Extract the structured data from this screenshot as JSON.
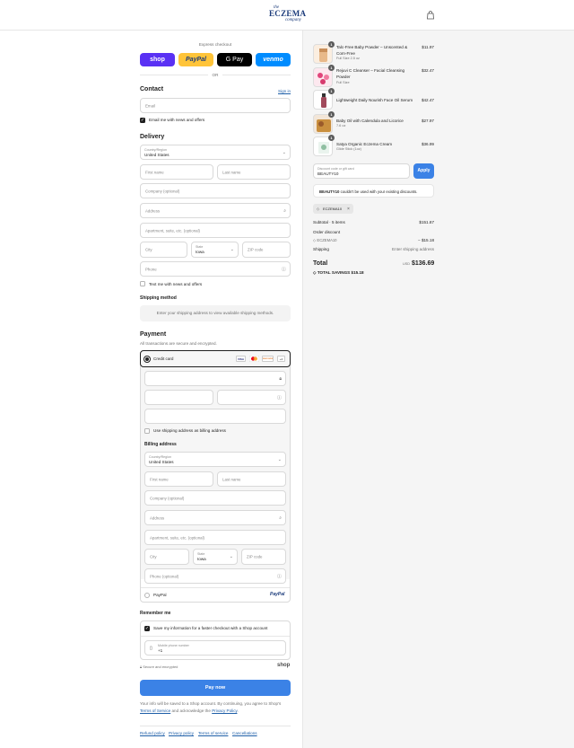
{
  "brand": {
    "line1": "the",
    "line2": "ECZEMA",
    "line3": "company"
  },
  "express": {
    "label": "Express checkout",
    "or": "OR",
    "buttons": [
      {
        "label": "shop",
        "color": "#5a31f4"
      },
      {
        "label": "PayPal",
        "color": "#ffc439"
      },
      {
        "label": "G Pay",
        "color": "#000000"
      },
      {
        "label": "venmo",
        "color": "#008cff"
      }
    ]
  },
  "contact": {
    "title": "Contact",
    "signin": "Sign in",
    "email_placeholder": "Email",
    "newsletter_label": "Email me with news and offers",
    "newsletter_checked": true
  },
  "delivery": {
    "title": "Delivery",
    "country_label": "Country/Region",
    "country_value": "United States",
    "first_name": "First name",
    "last_name": "Last name",
    "company": "Company (optional)",
    "address": "Address",
    "apartment": "Apartment, suite, etc. (optional)",
    "city": "City",
    "state_label": "State",
    "state_value": "Iowa",
    "zip": "ZIP code",
    "phone": "Phone",
    "sms_label": "Text me with news and offers"
  },
  "shipping": {
    "title": "Shipping method",
    "message": "Enter your shipping address to view available shipping methods."
  },
  "payment": {
    "title": "Payment",
    "subtitle": "All transactions are secure and encrypted.",
    "credit_card_label": "Credit card",
    "card_brands": [
      "VISA",
      "MC",
      "DISCOVER",
      "+4"
    ],
    "use_shipping_label": "Use shipping address as billing address",
    "billing_title": "Billing address",
    "billing": {
      "country_label": "Country/Region",
      "country_value": "United States",
      "first_name": "First name",
      "last_name": "Last name",
      "company": "Company (optional)",
      "address": "Address",
      "apartment": "Apartment, suite, etc. (optional)",
      "city": "City",
      "state_label": "State",
      "state_value": "Iowa",
      "zip": "ZIP code",
      "phone": "Phone (optional)"
    },
    "paypal_label": "PayPal",
    "paypal_logo": "PayPal"
  },
  "remember": {
    "title": "Remember me",
    "save_label": "Save my information for a faster checkout with a Shop account",
    "mobile_label": "Mobile phone number",
    "mobile_value": "+1",
    "secure_label": "Secure and encrypted",
    "shop_logo": "shop"
  },
  "pay_now": "Pay now",
  "legal": {
    "text1": "Your info will be saved to a Shop account. By continuing, you agree to Shop's",
    "terms": "Terms of Service",
    "text2": "and acknowledge the",
    "privacy": "Privacy Policy",
    "end": "."
  },
  "footer_links": [
    "Refund policy",
    "Privacy policy",
    "Terms of service",
    "Cancellations"
  ],
  "order": {
    "items": [
      {
        "qty": "1",
        "name": "Talc-Free Baby Powder – Unscented & Corn-Free",
        "variant": "Full Size 2.5 oz",
        "price": "$11.97"
      },
      {
        "qty": "1",
        "name": "Rejuvi C Cleanser – Facial Cleansing Powder",
        "variant": "Full Size",
        "price": "$32.47"
      },
      {
        "qty": "1",
        "name": "Lightweight Daily Nourish Face Oil Serum",
        "variant": "",
        "price": "$42.47"
      },
      {
        "qty": "1",
        "name": "Baby Oil with Calendula and Licorice",
        "variant": "7.6 oz",
        "price": "$27.97"
      },
      {
        "qty": "1",
        "name": "Satya Organic Eczema Cream",
        "variant": "Glide Stick (1oz)",
        "price": "$36.99"
      }
    ],
    "discount_label": "Discount code or gift card",
    "discount_value": "BEAUTY10",
    "apply": "Apply",
    "error_code": "BEAUTY10",
    "error_text": " couldn't be used with your existing discounts.",
    "tag": "ECZEMA10",
    "subtotal_label": "Subtotal · 5 items",
    "subtotal_value": "$151.87",
    "order_discount_label": "Order discount",
    "discount_code_label": "ECZEMA10",
    "discount_amount": "− $15.18",
    "shipping_label": "Shipping",
    "shipping_value": "Enter shipping address",
    "total_label": "Total",
    "currency": "USD",
    "total_value": "$136.69",
    "savings_label": "TOTAL SAVINGS",
    "savings_value": "$15.18"
  }
}
